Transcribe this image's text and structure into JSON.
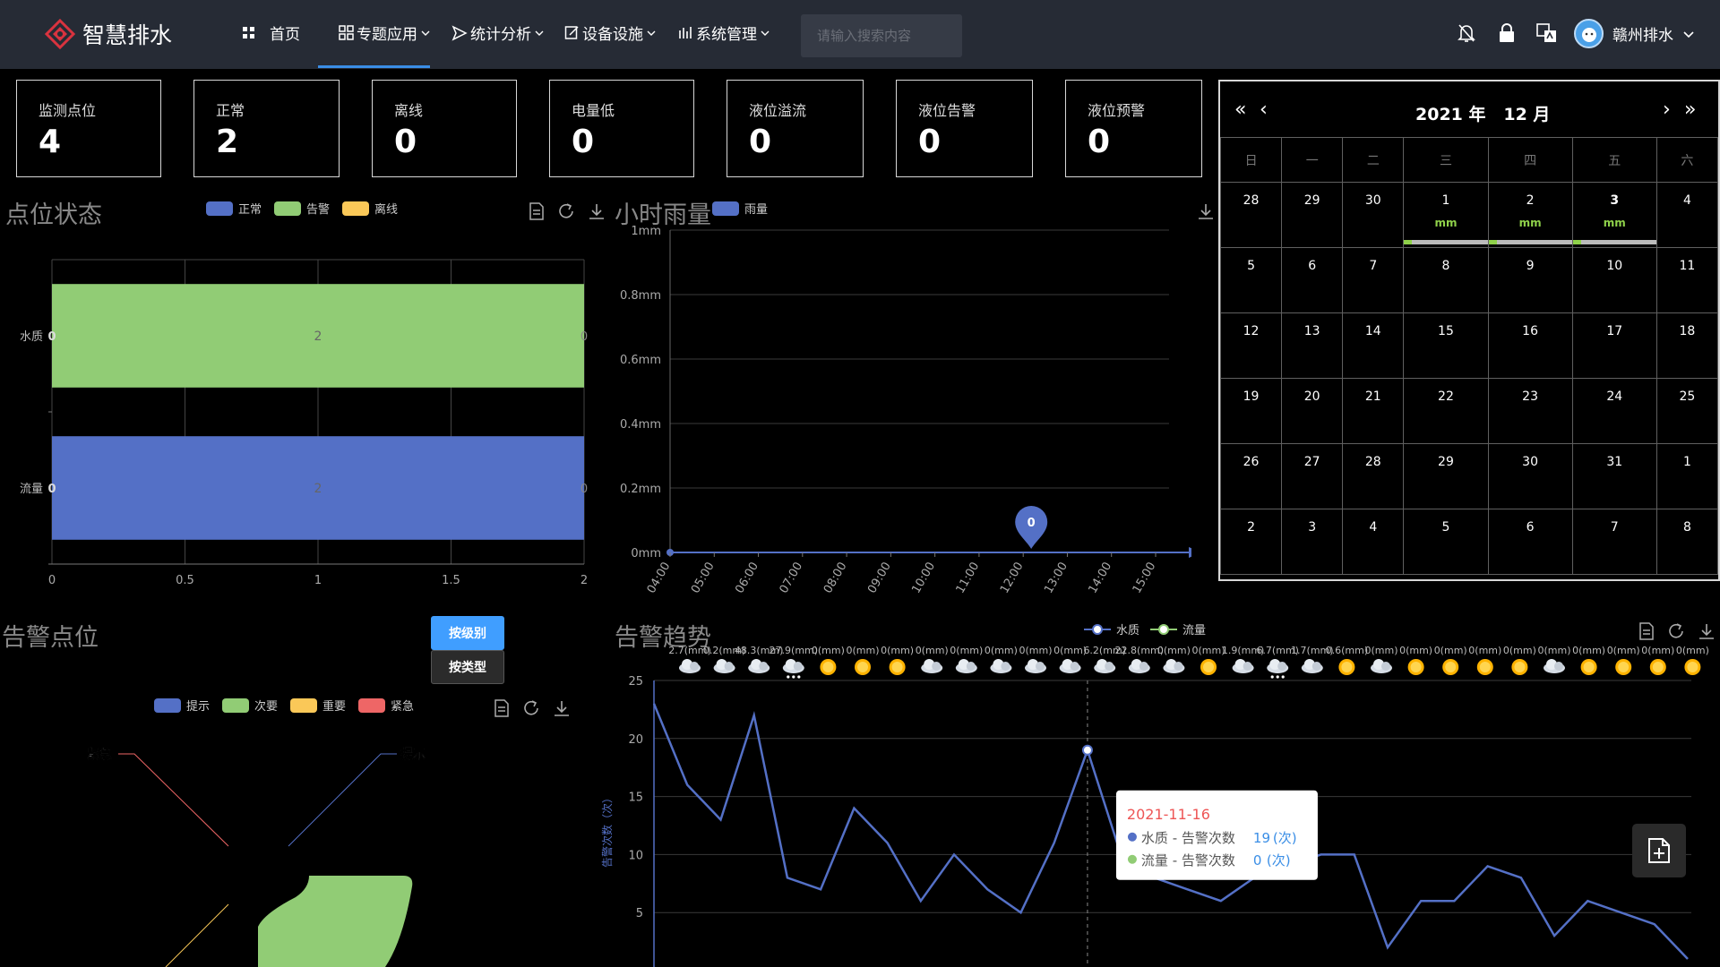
{
  "header": {
    "app_title": "智慧排水",
    "nav": [
      {
        "label": "首页",
        "icon": "grid-icon"
      },
      {
        "label": "专题应用",
        "icon": "apps-icon"
      },
      {
        "label": "统计分析",
        "icon": "send-icon"
      },
      {
        "label": "设备设施",
        "icon": "edit-icon"
      },
      {
        "label": "系统管理",
        "icon": "manage-icon"
      }
    ],
    "search_placeholder": "请输入搜索内容",
    "user_name": "赣州排水"
  },
  "stats": [
    {
      "label": "监测点位",
      "value": "4"
    },
    {
      "label": "正常",
      "value": "2"
    },
    {
      "label": "离线",
      "value": "0"
    },
    {
      "label": "电量低",
      "value": "0"
    },
    {
      "label": "液位溢流",
      "value": "0"
    },
    {
      "label": "液位告警",
      "value": "0"
    },
    {
      "label": "液位预警",
      "value": "0"
    }
  ],
  "point_status": {
    "title": "点位状态",
    "legend": [
      {
        "name": "正常",
        "color": "#5470c6"
      },
      {
        "name": "告警",
        "color": "#91cc75"
      },
      {
        "name": "离线",
        "color": "#fac858"
      }
    ]
  },
  "hourly_rain": {
    "title": "小时雨量",
    "legend": [
      {
        "name": "雨量",
        "color": "#5470c6"
      }
    ]
  },
  "alarm_points": {
    "title": "告警点位",
    "btn_level": "按级别",
    "btn_type": "按类型",
    "legend": [
      {
        "name": "提示",
        "color": "#5470c6"
      },
      {
        "name": "次要",
        "color": "#91cc75"
      },
      {
        "name": "重要",
        "color": "#fac858"
      },
      {
        "name": "紧急",
        "color": "#ee6666"
      }
    ],
    "labels": {
      "urgent": "紧急",
      "hint": "提示"
    }
  },
  "alarm_trend": {
    "title": "告警趋势",
    "legend": [
      {
        "name": "水质",
        "color": "#5470c6"
      },
      {
        "name": "流量",
        "color": "#91cc75"
      }
    ],
    "weather_labels": [
      "2.7(mm)",
      "0.2(mm)",
      "48.3(mm)",
      "27.9(mm)",
      "0(mm)",
      "0(mm)",
      "0(mm)",
      "0(mm)",
      "0(mm)",
      "0(mm)",
      "0(mm)",
      "0(mm)",
      "6.2(mm)",
      "22.8(mm)",
      "0(mm)",
      "0(mm)",
      "1.9(mm)",
      "6.7(mm)",
      "1.7(mm)",
      "0.6(mm)",
      "0(mm)",
      "0(mm)",
      "0(mm)",
      "0(mm)",
      "0(mm)",
      "0(mm)",
      "0(mm)",
      "0(mm)",
      "0(mm)",
      "0(mm)"
    ],
    "weather_icons": [
      "cloud-icon",
      "cloud-icon",
      "cloud-icon",
      "snow-cloud-icon",
      "sun-icon",
      "sun-icon",
      "sun-icon",
      "cloud-icon",
      "cloud-icon",
      "cloud-icon",
      "cloud-icon",
      "cloud-icon",
      "cloud-icon",
      "cloud-icon",
      "cloud-icon",
      "sun-icon",
      "cloud-icon",
      "snow-cloud-icon",
      "cloud-icon",
      "sun-icon",
      "cloud-icon",
      "sun-icon",
      "sun-icon",
      "sun-icon",
      "sun-icon",
      "cloud-icon",
      "sun-icon",
      "sun-icon",
      "sun-icon",
      "sun-icon"
    ],
    "tooltip": {
      "date": "2021-11-16",
      "row1_name": "水质 - 告警次数",
      "row1_value": "19",
      "row1_unit": "(次)",
      "row2_name": "流量 - 告警次数",
      "row2_value": "0",
      "row2_unit": "(次)"
    }
  },
  "calendar": {
    "year_label": "2021 年",
    "month_label": "12 月",
    "weekdays": [
      "日",
      "一",
      "二",
      "三",
      "四",
      "五",
      "六"
    ],
    "weeks": [
      [
        {
          "d": "28"
        },
        {
          "d": "29"
        },
        {
          "d": "30"
        },
        {
          "d": "1",
          "cur": true,
          "mm": "mm"
        },
        {
          "d": "2",
          "cur": true,
          "mm": "mm"
        },
        {
          "d": "3",
          "cur": true,
          "mm": "mm",
          "bold": true
        },
        {
          "d": "4",
          "cur": true
        }
      ],
      [
        {
          "d": "5",
          "cur": true
        },
        {
          "d": "6",
          "cur": true
        },
        {
          "d": "7",
          "cur": true
        },
        {
          "d": "8",
          "cur": true
        },
        {
          "d": "9",
          "cur": true
        },
        {
          "d": "10",
          "cur": true
        },
        {
          "d": "11",
          "cur": true
        }
      ],
      [
        {
          "d": "12",
          "cur": true
        },
        {
          "d": "13",
          "cur": true
        },
        {
          "d": "14",
          "cur": true
        },
        {
          "d": "15",
          "cur": true
        },
        {
          "d": "16",
          "cur": true
        },
        {
          "d": "17",
          "cur": true
        },
        {
          "d": "18",
          "cur": true
        }
      ],
      [
        {
          "d": "19",
          "cur": true
        },
        {
          "d": "20",
          "cur": true
        },
        {
          "d": "21",
          "cur": true
        },
        {
          "d": "22",
          "cur": true
        },
        {
          "d": "23",
          "cur": true
        },
        {
          "d": "24",
          "cur": true
        },
        {
          "d": "25",
          "cur": true
        }
      ],
      [
        {
          "d": "26",
          "cur": true
        },
        {
          "d": "27",
          "cur": true
        },
        {
          "d": "28",
          "cur": true
        },
        {
          "d": "29",
          "cur": true
        },
        {
          "d": "30",
          "cur": true
        },
        {
          "d": "31",
          "cur": true
        },
        {
          "d": "1"
        }
      ],
      [
        {
          "d": "2"
        },
        {
          "d": "3"
        },
        {
          "d": "4"
        },
        {
          "d": "5"
        },
        {
          "d": "6"
        },
        {
          "d": "7"
        },
        {
          "d": "8"
        }
      ]
    ]
  },
  "chart_data": [
    {
      "type": "bar",
      "orientation": "horizontal",
      "stacked": true,
      "categories": [
        "流量",
        "水质"
      ],
      "series": [
        {
          "name": "正常",
          "values": [
            2,
            0
          ]
        },
        {
          "name": "告警",
          "values": [
            0,
            2
          ]
        },
        {
          "name": "离线",
          "values": [
            0,
            0
          ]
        }
      ],
      "xlim": [
        0,
        2
      ],
      "xticks": [
        "0",
        "0.5",
        "1",
        "1.5",
        "2"
      ],
      "grid": true,
      "legend_position": "top"
    },
    {
      "type": "line",
      "x": [
        "04:00",
        "05:00",
        "06:00",
        "07:00",
        "08:00",
        "09:00",
        "10:00",
        "11:00",
        "12:00",
        "13:00",
        "14:00",
        "15:00"
      ],
      "series": [
        {
          "name": "雨量",
          "values": [
            0,
            0,
            0,
            0,
            0,
            0,
            0,
            0,
            0,
            0,
            0,
            0
          ]
        }
      ],
      "ylim": [
        0,
        1
      ],
      "yticks": [
        "0mm",
        "0.2mm",
        "0.4mm",
        "0.6mm",
        "0.8mm",
        "1mm"
      ],
      "marker_label": "0",
      "end_label": "0",
      "grid": true,
      "legend_position": "top"
    },
    {
      "type": "line",
      "ylabel": "告警次数（次）",
      "ylim": [
        0,
        25
      ],
      "yticks": [
        "5",
        "10",
        "15",
        "20",
        "25"
      ],
      "series": [
        {
          "name": "水质",
          "values": [
            23,
            16,
            13,
            22,
            8,
            7,
            14,
            11,
            6,
            10,
            7,
            5,
            11,
            19,
            10,
            8,
            7,
            6,
            8,
            9,
            10,
            10,
            2,
            6,
            6,
            9,
            8,
            3,
            6,
            5,
            4,
            1
          ]
        },
        {
          "name": "流量",
          "values": [
            0,
            0,
            0,
            0,
            0,
            0,
            0,
            0,
            0,
            0,
            0,
            0,
            0,
            0,
            0,
            0,
            0,
            0,
            0,
            0,
            0,
            0,
            0,
            0,
            0,
            0,
            0,
            0,
            0,
            0,
            0,
            0
          ]
        }
      ],
      "highlight_index": 13,
      "grid": true,
      "legend_position": "top"
    }
  ]
}
